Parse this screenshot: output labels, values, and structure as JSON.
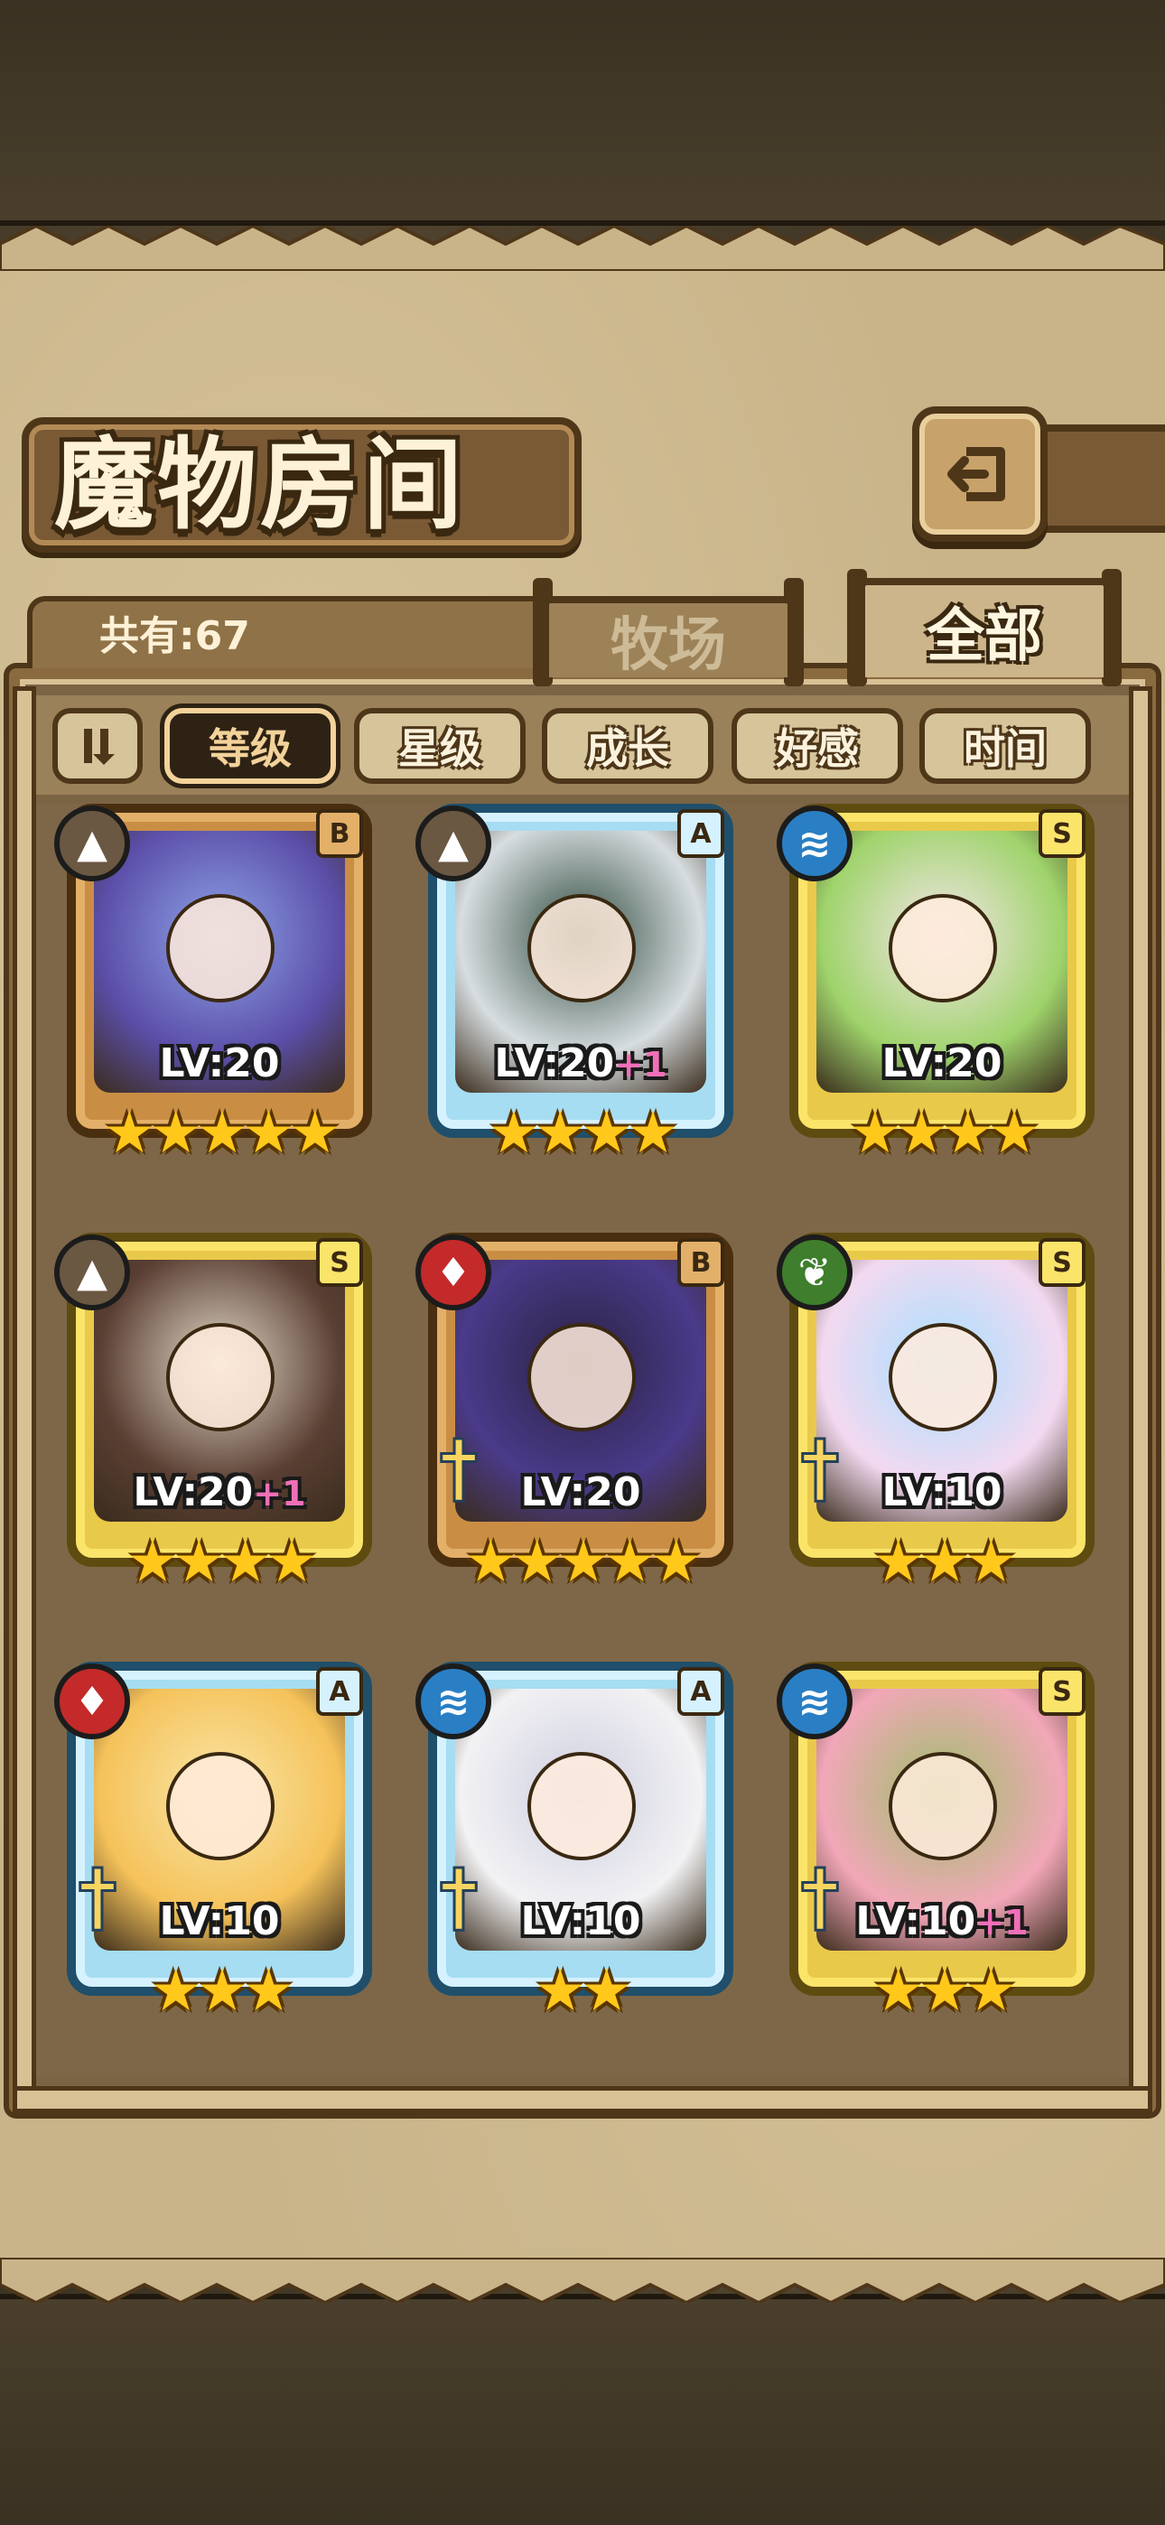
{
  "header": {
    "title": "魔物房间"
  },
  "collection": {
    "count_label": "共有:67"
  },
  "tabs": [
    {
      "label": "牧场",
      "active": false
    },
    {
      "label": "全部",
      "active": true
    }
  ],
  "sort": {
    "toggle_icon": "sort-order-icon",
    "options": [
      {
        "label": "等级",
        "active": true
      },
      {
        "label": "星级",
        "active": false
      },
      {
        "label": "成长",
        "active": false
      },
      {
        "label": "好感",
        "active": false
      },
      {
        "label": "时间",
        "active": false
      }
    ]
  },
  "monsters": [
    {
      "level": "LV:20",
      "plus": "",
      "stars": "★★★★★",
      "rank": "B",
      "element": "earth",
      "frame": "bronze",
      "weapon": false,
      "art_colors": [
        "#5b4ea8",
        "#8ea4e8"
      ]
    },
    {
      "level": "LV:20",
      "plus": "+1",
      "stars": "★★★★",
      "rank": "A",
      "element": "earth",
      "frame": "blue",
      "weapon": false,
      "art_colors": [
        "#d7dde0",
        "#2f4a3d"
      ]
    },
    {
      "level": "LV:20",
      "plus": "",
      "stars": "★★★★",
      "rank": "S",
      "element": "water",
      "frame": "gold",
      "weapon": false,
      "art_colors": [
        "#9fd36b",
        "#f5e6ea"
      ]
    },
    {
      "level": "LV:20",
      "plus": "+1",
      "stars": "★★★★",
      "rank": "S",
      "element": "earth",
      "frame": "gold",
      "weapon": false,
      "art_colors": [
        "#5a3f33",
        "#e3dac9"
      ]
    },
    {
      "level": "LV:20",
      "plus": "",
      "stars": "★★★★★",
      "rank": "B",
      "element": "fire",
      "frame": "bronze",
      "weapon": true,
      "art_colors": [
        "#4a3a8a",
        "#2a2240"
      ]
    },
    {
      "level": "LV:10",
      "plus": "",
      "stars": "★★★",
      "rank": "S",
      "element": "wood",
      "frame": "gold",
      "weapon": true,
      "art_colors": [
        "#f3d9f0",
        "#a7e0ff"
      ]
    },
    {
      "level": "LV:10",
      "plus": "",
      "stars": "★★★",
      "rank": "A",
      "element": "fire",
      "frame": "blue",
      "weapon": true,
      "art_colors": [
        "#f5c25a",
        "#f9e6a8"
      ]
    },
    {
      "level": "LV:10",
      "plus": "",
      "stars": "★★",
      "rank": "A",
      "element": "water",
      "frame": "blue",
      "weapon": true,
      "art_colors": [
        "#f2f2f4",
        "#cfcfe0"
      ]
    },
    {
      "level": "LV:10",
      "plus": "+1",
      "stars": "★★★",
      "rank": "S",
      "element": "water",
      "frame": "gold",
      "weapon": true,
      "art_colors": [
        "#f2a7b8",
        "#9cbf6a"
      ]
    }
  ],
  "colors": {
    "parchment": "#c9b48a",
    "frame_dark": "#4e3619",
    "star": "#ffc81a",
    "plus_level": "#f06fb8"
  }
}
